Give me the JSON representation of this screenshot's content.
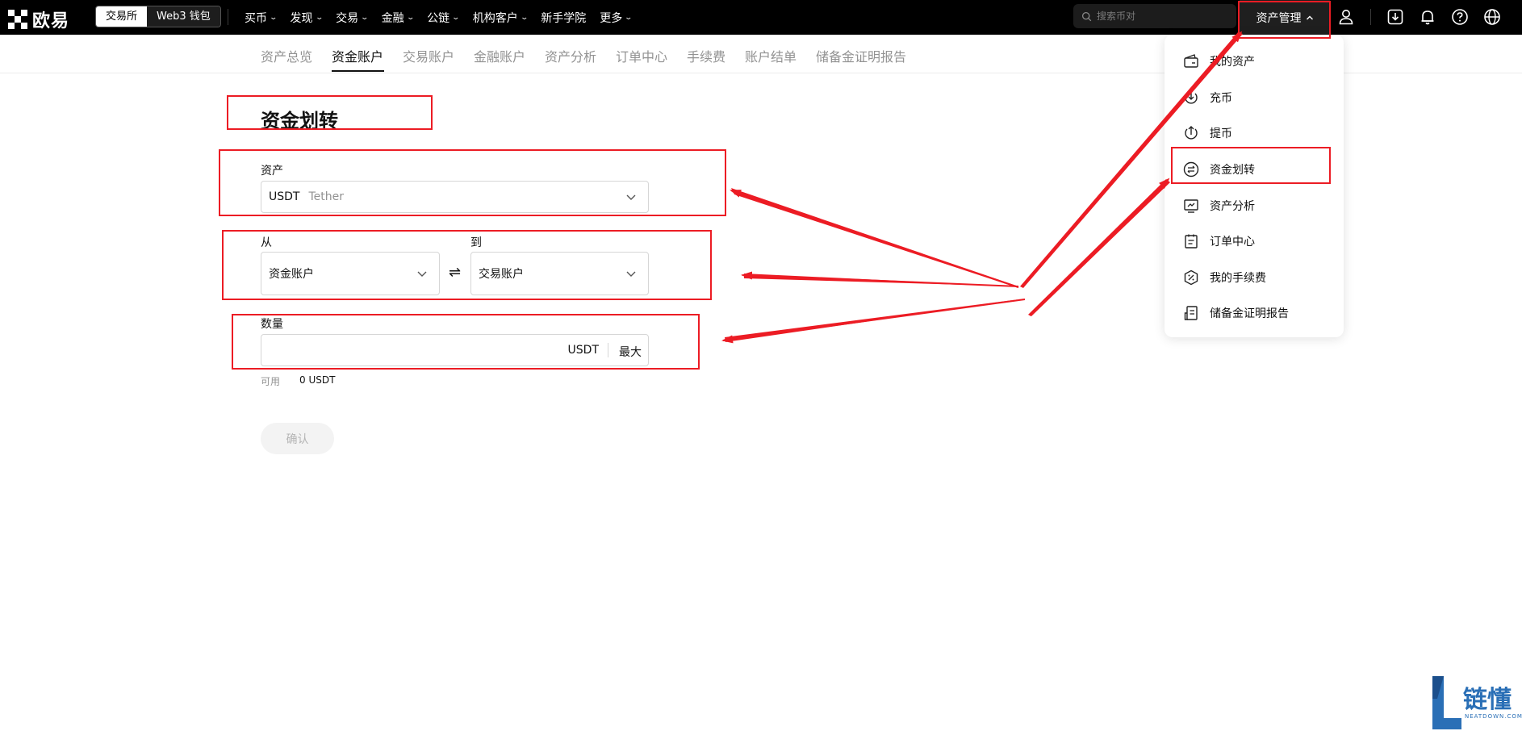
{
  "header": {
    "logo_text": "欧易",
    "segments": [
      {
        "label": "交易所",
        "active": true
      },
      {
        "label": "Web3 钱包",
        "active": false
      }
    ],
    "nav": [
      {
        "label": "买币",
        "dropdown": true
      },
      {
        "label": "发现",
        "dropdown": true
      },
      {
        "label": "交易",
        "dropdown": true
      },
      {
        "label": "金融",
        "dropdown": true
      },
      {
        "label": "公链",
        "dropdown": true
      },
      {
        "label": "机构客户",
        "dropdown": true
      },
      {
        "label": "新手学院",
        "dropdown": false
      },
      {
        "label": "更多",
        "dropdown": true
      }
    ],
    "search_placeholder": "搜索币对",
    "asset_management_label": "资产管理",
    "icons": [
      "user-icon",
      "download-icon",
      "bell-icon",
      "help-icon",
      "globe-icon"
    ]
  },
  "subnav": {
    "items": [
      {
        "label": "资产总览",
        "active": false
      },
      {
        "label": "资金账户",
        "active": true
      },
      {
        "label": "交易账户",
        "active": false
      },
      {
        "label": "金融账户",
        "active": false
      },
      {
        "label": "资产分析",
        "active": false
      },
      {
        "label": "订单中心",
        "active": false
      },
      {
        "label": "手续费",
        "active": false
      },
      {
        "label": "账户结单",
        "active": false
      },
      {
        "label": "储备金证明报告",
        "active": false
      }
    ]
  },
  "transfer": {
    "title": "资金划转",
    "asset_label": "资产",
    "asset_symbol": "USDT",
    "asset_name": "Tether",
    "from_label": "从",
    "from_value": "资金账户",
    "to_label": "到",
    "to_value": "交易账户",
    "swap_glyph": "⇌",
    "amount_label": "数量",
    "amount_value": "",
    "amount_unit": "USDT",
    "max_label": "最大",
    "available_label": "可用",
    "available_value": "0 USDT",
    "confirm_label": "确认"
  },
  "asset_menu": {
    "items": [
      {
        "label": "我的资产",
        "icon": "wallet-icon"
      },
      {
        "label": "充币",
        "icon": "deposit-icon"
      },
      {
        "label": "提币",
        "icon": "withdraw-icon"
      },
      {
        "label": "资金划转",
        "icon": "transfer-icon"
      },
      {
        "label": "资产分析",
        "icon": "analysis-icon"
      },
      {
        "label": "订单中心",
        "icon": "order-center-icon"
      },
      {
        "label": "我的手续费",
        "icon": "fee-icon"
      },
      {
        "label": "储备金证明报告",
        "icon": "reserve-report-icon"
      }
    ]
  },
  "watermark": {
    "text": "链懂",
    "sub": "NEATDOWN.COM"
  },
  "colors": {
    "topbar": "#000000",
    "annotation": "#ec1c24",
    "watermark": "#2a6fb6",
    "muted_text": "#929292"
  }
}
